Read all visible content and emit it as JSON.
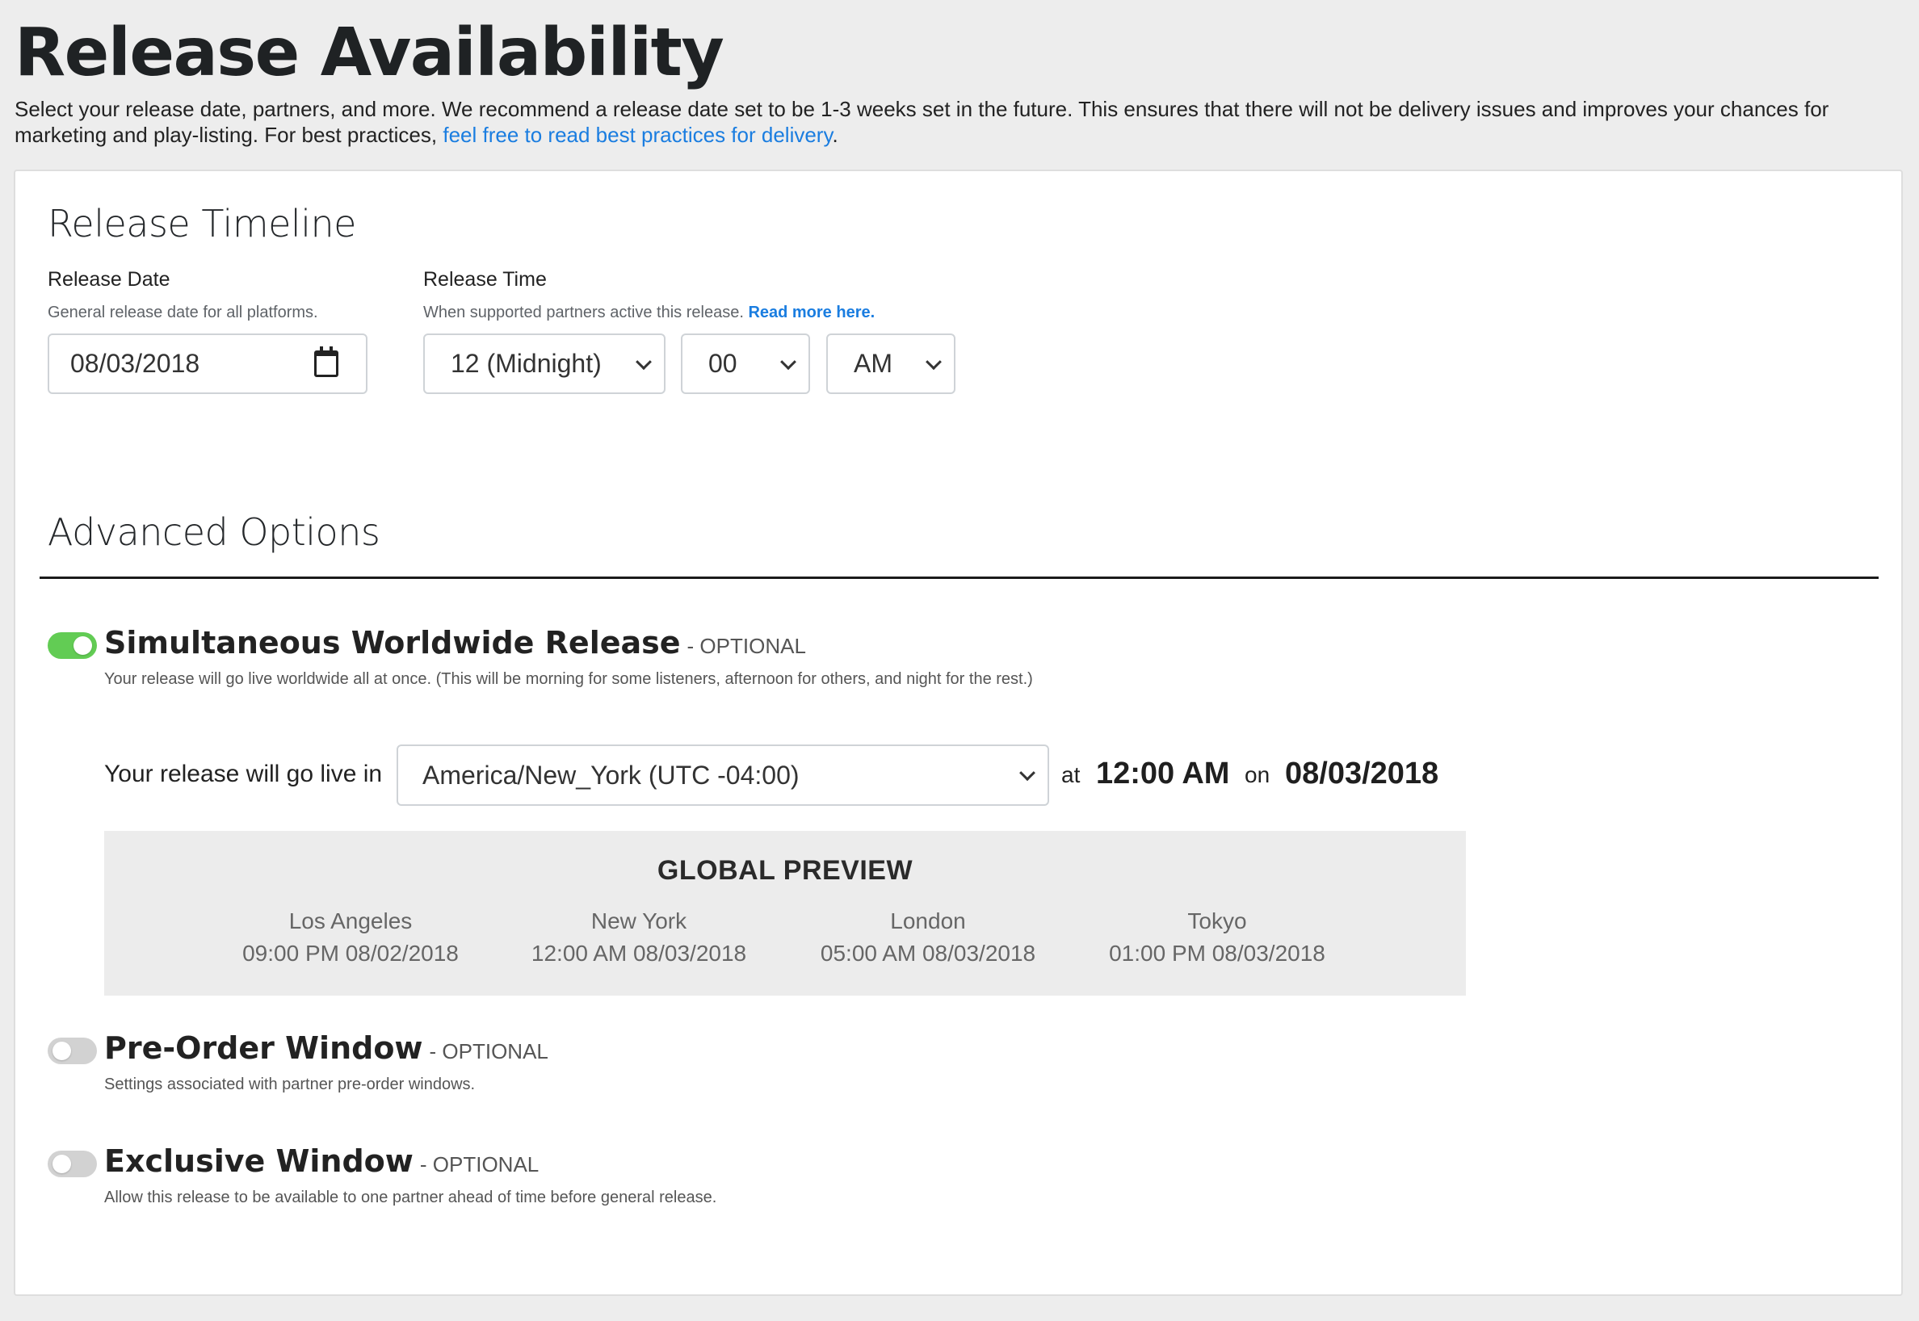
{
  "page": {
    "title": "Release Availability",
    "intro_text": "Select your release date, partners, and more. We recommend a release date set to be 1-3 weeks set in the future. This ensures that there will not be delivery issues and improves your chances for marketing and play-listing. For best practices, ",
    "intro_link": "feel free to read best practices for delivery",
    "intro_end": "."
  },
  "timeline": {
    "title": "Release Timeline",
    "date_label": "Release Date",
    "date_help": "General release date for all platforms.",
    "date_value": "08/03/2018",
    "time_label": "Release Time",
    "time_help": "When supported partners active this release. ",
    "time_help_link": "Read more here.",
    "hour_value": "12 (Midnight)",
    "minute_value": "00",
    "ampm_value": "AM"
  },
  "advanced": {
    "title": "Advanced Options",
    "simultaneous": {
      "title": "Simultaneous Worldwide Release",
      "tag": "- OPTIONAL",
      "desc": "Your release will go live worldwide all at once. (This will be morning for some listeners, afternoon for others, and night for the rest.)",
      "enabled": true,
      "live_label": "Your release will go live in",
      "timezone": "America/New_York (UTC -04:00)",
      "at_label": "at",
      "time": "12:00 AM",
      "on_label": "on",
      "date": "08/03/2018"
    },
    "preview": {
      "title": "GLOBAL PREVIEW",
      "cities": [
        {
          "name": "Los Angeles",
          "time": "09:00 PM 08/02/2018"
        },
        {
          "name": "New York",
          "time": "12:00 AM 08/03/2018"
        },
        {
          "name": "London",
          "time": "05:00 AM 08/03/2018"
        },
        {
          "name": "Tokyo",
          "time": "01:00 PM 08/03/2018"
        }
      ]
    },
    "preorder": {
      "title": "Pre-Order Window",
      "tag": "- OPTIONAL",
      "desc": "Settings associated with partner pre-order windows.",
      "enabled": false
    },
    "exclusive": {
      "title": "Exclusive Window",
      "tag": "- OPTIONAL",
      "desc": "Allow this release to be available to one partner ahead of time before general release.",
      "enabled": false
    }
  },
  "colors": {
    "link": "#1a7de0",
    "toggle_on": "#62cc54",
    "toggle_off": "#d2d2d2"
  }
}
